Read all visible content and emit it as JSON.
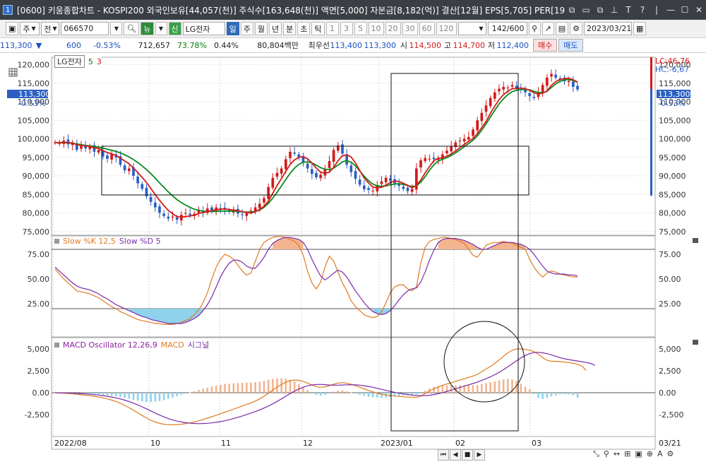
{
  "window": {
    "title": "[0600] 키움종합차트 - KOSPI200 외국인보유[44,057(천)] 주식수[163,648(천)] 액면[5,000] 자본금[8,182(억)] 결산[12월] EPS[5,705] PER[19.",
    "app_icon": "1"
  },
  "toolbar": {
    "period_type": "주",
    "market": "전",
    "code": "066570",
    "name": "LG전자",
    "new_label": "신",
    "units": [
      "일",
      "주",
      "월",
      "년",
      "분",
      "초",
      "틱"
    ],
    "minutes": [
      "1",
      "3",
      "5",
      "10",
      "20",
      "30",
      "60",
      "120"
    ],
    "count": "142",
    "count_total": "/600",
    "date": "2023/03/21"
  },
  "quote": {
    "price": "113,300",
    "change": "600",
    "change_pct": "-0.53%",
    "volume": "712,657",
    "vol_ratio": "73.78%",
    "turnover": "0.44%",
    "amount": "80,804백만",
    "best_ask_label": "최우선",
    "best_ask": "113,400",
    "best_bid": "113,300",
    "open_label": "시",
    "open": "114,500",
    "high_label": "고",
    "high": "114,700",
    "low_label": "저",
    "low": "112,400",
    "buy_label": "매수",
    "sell_label": "매도"
  },
  "price_panel": {
    "legend_name": "LG전자",
    "ma_short": "5",
    "ma_long": "3",
    "lc": "LC:46,76",
    "hc": "HC:-6,67",
    "last_price": "113,300",
    "last_change": "-0.53%"
  },
  "stoch_panel": {
    "legend_k": "Slow %K 12,5",
    "legend_d": "Slow %D 5"
  },
  "macd_panel": {
    "legend_osc": "MACD Oscillator 12,26,9",
    "legend_macd": "MACD",
    "legend_signal": "시그널"
  },
  "xaxis": {
    "labels": [
      "2022/08",
      "10",
      "11",
      "12",
      "2023/01",
      "02",
      "03"
    ],
    "right_label": "03/21"
  },
  "colors": {
    "up": "#d21a1a",
    "down": "#2a5fc4",
    "ma5": "#d21a1a",
    "ma20": "#0a8a1a",
    "stoch_k": "#e07a20",
    "stoch_d": "#7a2aa8",
    "macd": "#e07a20",
    "signal": "#7a2aa8",
    "osc_up": "#f3b48f",
    "osc_down": "#8fd2ec"
  },
  "chart_data": [
    {
      "type": "candlestick",
      "title": "LG전자",
      "ylim": [
        74000,
        122000
      ],
      "yticks": [
        75000,
        80000,
        85000,
        90000,
        95000,
        100000,
        105000,
        110000,
        115000,
        120000
      ],
      "ytick_labels": [
        "75,000",
        "80,000",
        "85,000",
        "90,000",
        "95,000",
        "100,000",
        "105,000",
        "110,000",
        "115,000",
        "120,000"
      ],
      "close": [
        99000,
        98800,
        99500,
        98500,
        99000,
        97000,
        98200,
        97400,
        98000,
        96500,
        97000,
        95200,
        94600,
        96000,
        95000,
        93000,
        91500,
        92000,
        90000,
        88000,
        86500,
        84500,
        83000,
        81500,
        80000,
        79200,
        78500,
        79000,
        78200,
        79500,
        80000,
        79400,
        79800,
        80800,
        80200,
        81200,
        80600,
        81500,
        81100,
        80900,
        80300,
        80800,
        79800,
        79400,
        79900,
        80600,
        81500,
        82500,
        84000,
        87000,
        89500,
        90800,
        92000,
        94500,
        96500,
        96000,
        95000,
        93500,
        92000,
        90500,
        89600,
        90300,
        91800,
        94000,
        97000,
        98200,
        96000,
        93000,
        91000,
        89200,
        87600,
        86400,
        86200,
        86000,
        87500,
        88500,
        89500,
        88800,
        88000,
        87300,
        86500,
        85900,
        86500,
        92000,
        94200,
        94800,
        94600,
        94500,
        94800,
        95800,
        96800,
        98000,
        99000,
        99500,
        100000,
        100500,
        102500,
        105000,
        107000,
        109000,
        111000,
        112500,
        113500,
        114000,
        113800,
        114500,
        113600,
        113200,
        112500,
        111500,
        111000,
        112500,
        114500,
        116500,
        117500,
        116500,
        116000,
        115500,
        115600,
        114000,
        113300
      ],
      "ma5": [
        99000,
        98900,
        99100,
        98900,
        98900,
        98400,
        98200,
        98100,
        97900,
        97600,
        97400,
        96800,
        96300,
        95900,
        95500,
        94800,
        94000,
        93300,
        92100,
        90900,
        89600,
        88200,
        86600,
        85000,
        83400,
        82000,
        80700,
        79800,
        79000,
        78900,
        79000,
        79200,
        79400,
        79900,
        80100,
        80400,
        80600,
        80900,
        81000,
        81100,
        80900,
        80800,
        80600,
        80300,
        80100,
        80000,
        80300,
        81000,
        81800,
        83200,
        85300,
        87400,
        89300,
        91200,
        93100,
        94300,
        95000,
        95200,
        94600,
        93500,
        92100,
        91000,
        90700,
        91000,
        92300,
        94100,
        95400,
        95700,
        95100,
        93500,
        91400,
        89400,
        88100,
        87000,
        86800,
        86900,
        87500,
        88200,
        88600,
        88500,
        88000,
        87400,
        86800,
        87400,
        88900,
        90800,
        92500,
        94100,
        94700,
        94900,
        95300,
        95900,
        96700,
        97600,
        98500,
        99300,
        100100,
        101400,
        103000,
        104700,
        106900,
        108800,
        110600,
        111900,
        112800,
        113500,
        113600,
        113700,
        113500,
        113100,
        112400,
        112100,
        112300,
        112900,
        114400,
        115400,
        116000,
        116300,
        116300,
        115900,
        115300
      ],
      "ma20": [
        99000,
        98950,
        99000,
        98900,
        98800,
        98600,
        98400,
        98200,
        98100,
        97900,
        97800,
        97500,
        97200,
        96900,
        96600,
        96200,
        95700,
        95100,
        94400,
        93600,
        92700,
        91700,
        90600,
        89400,
        88100,
        86900,
        85700,
        84600,
        83600,
        82800,
        82100,
        81500,
        81000,
        80700,
        80500,
        80400,
        80400,
        80400,
        80500,
        80500,
        80500,
        80500,
        80400,
        80300,
        80200,
        80200,
        80400,
        80800,
        81500,
        82600,
        84000,
        85600,
        87300,
        89000,
        90700,
        92100,
        93100,
        93700,
        93800,
        93500,
        92900,
        92200,
        91800,
        91700,
        92100,
        92900,
        93800,
        94100,
        93700,
        92700,
        91300,
        89900,
        88700,
        87800,
        87300,
        87200,
        87300,
        87600,
        87800,
        87900,
        87700,
        87400,
        87100,
        87300,
        88300,
        89800,
        91500,
        93000,
        94000,
        94500,
        94900,
        95500,
        96200,
        97000,
        97900,
        98700,
        99600,
        100800,
        102300,
        104000,
        105900,
        107700,
        109400,
        110800,
        111900,
        112700,
        113100,
        113300,
        113300,
        113200,
        112800,
        112500,
        112400,
        112800,
        113800,
        114800,
        115500,
        115900,
        116000,
        115700,
        115200
      ]
    },
    {
      "type": "line",
      "title": "Slow %K 12,5 / Slow %D 5",
      "ylim": [
        0,
        100
      ],
      "yticks": [
        25,
        50,
        75
      ],
      "ytick_labels": [
        "25.00",
        "50.00",
        "75.00"
      ],
      "reference_lines": [
        20,
        80
      ],
      "series": [
        {
          "name": "Slow %K 12,5",
          "values": [
            60,
            55,
            50,
            46,
            42,
            38,
            37,
            36,
            35,
            33,
            31,
            28,
            25,
            22,
            20,
            17,
            15,
            13,
            11,
            9,
            8,
            7,
            6,
            5,
            5,
            4,
            4,
            4,
            5,
            6,
            8,
            10,
            14,
            19,
            26,
            36,
            50,
            62,
            70,
            75,
            73,
            70,
            64,
            58,
            54,
            56,
            68,
            80,
            87,
            90,
            92,
            93,
            93,
            92,
            90,
            88,
            84,
            74,
            58,
            46,
            40,
            47,
            62,
            73,
            68,
            57,
            46,
            38,
            28,
            22,
            18,
            14,
            12,
            11,
            12,
            17,
            26,
            36,
            42,
            44,
            44,
            40,
            38,
            42,
            66,
            82,
            88,
            90,
            91,
            92,
            92,
            91,
            90,
            88,
            86,
            80,
            74,
            72,
            78,
            84,
            86,
            87,
            87,
            88,
            87,
            86,
            84,
            82,
            80,
            70,
            62,
            56,
            52,
            56,
            58,
            57,
            55,
            54,
            53,
            52,
            52
          ]
        },
        {
          "name": "Slow %D 5",
          "values": [
            62,
            58,
            54,
            50,
            46,
            43,
            41,
            40,
            39,
            37,
            35,
            32,
            30,
            27,
            24,
            22,
            20,
            18,
            16,
            14,
            12,
            11,
            9,
            8,
            7,
            6,
            5,
            5,
            5,
            5,
            6,
            8,
            10,
            13,
            18,
            24,
            32,
            42,
            52,
            60,
            66,
            69,
            69,
            67,
            63,
            61,
            61,
            66,
            72,
            80,
            86,
            89,
            91,
            92,
            92,
            91,
            90,
            87,
            80,
            70,
            61,
            53,
            49,
            52,
            56,
            59,
            57,
            52,
            45,
            38,
            32,
            26,
            21,
            17,
            15,
            14,
            15,
            18,
            23,
            29,
            34,
            38,
            40,
            41,
            47,
            57,
            69,
            79,
            87,
            90,
            91,
            91,
            91,
            90,
            89,
            87,
            85,
            82,
            80,
            80,
            82,
            84,
            86,
            87,
            87,
            87,
            86,
            85,
            83,
            80,
            75,
            69,
            63,
            58,
            56,
            55,
            55,
            55,
            54,
            54,
            53
          ]
        }
      ]
    },
    {
      "type": "bar+line",
      "title": "MACD Oscillator 12,26,9",
      "ylim": [
        -4500,
        6000
      ],
      "yticks": [
        -2500,
        0,
        2500,
        5000
      ],
      "ytick_labels": [
        "-2,500",
        "0.00",
        "2,500",
        "5,000"
      ],
      "series": [
        {
          "name": "MACD",
          "values": [
            0,
            -40,
            -60,
            -90,
            -120,
            -180,
            -230,
            -280,
            -330,
            -400,
            -480,
            -580,
            -700,
            -850,
            -1000,
            -1200,
            -1450,
            -1700,
            -2000,
            -2300,
            -2600,
            -2900,
            -3150,
            -3350,
            -3500,
            -3600,
            -3650,
            -3660,
            -3640,
            -3600,
            -3520,
            -3440,
            -3330,
            -3200,
            -3060,
            -2900,
            -2740,
            -2570,
            -2400,
            -2220,
            -2050,
            -1880,
            -1700,
            -1520,
            -1340,
            -1160,
            -950,
            -700,
            -400,
            -50,
            300,
            650,
            950,
            1200,
            1370,
            1450,
            1420,
            1300,
            1100,
            880,
            700,
            620,
            680,
            800,
            970,
            1100,
            1150,
            1080,
            960,
            800,
            620,
            440,
            260,
            100,
            -40,
            -160,
            -260,
            -330,
            -380,
            -420,
            -460,
            -500,
            -520,
            -540,
            -380,
            -100,
            200,
            450,
            650,
            850,
            1000,
            1150,
            1300,
            1450,
            1600,
            1750,
            1900,
            2100,
            2400,
            2700,
            3000,
            3350,
            3750,
            4150,
            4550,
            4850,
            5000,
            5000,
            4950,
            4850,
            4700,
            4400,
            4000,
            3700,
            3600,
            3580,
            3550,
            3500,
            3450,
            3350,
            3250,
            3050,
            2550
          ]
        },
        {
          "name": "시그널",
          "values": [
            0,
            -10,
            -20,
            -35,
            -55,
            -80,
            -110,
            -140,
            -180,
            -220,
            -270,
            -330,
            -400,
            -490,
            -590,
            -710,
            -850,
            -1010,
            -1190,
            -1390,
            -1610,
            -1840,
            -2080,
            -2320,
            -2550,
            -2760,
            -2950,
            -3110,
            -3240,
            -3340,
            -3420,
            -3480,
            -3510,
            -3530,
            -3520,
            -3490,
            -3440,
            -3380,
            -3300,
            -3200,
            -3080,
            -2950,
            -2810,
            -2650,
            -2490,
            -2320,
            -2150,
            -1960,
            -1750,
            -1520,
            -1270,
            -990,
            -700,
            -400,
            -100,
            180,
            430,
            630,
            790,
            890,
            940,
            950,
            920,
            880,
            860,
            860,
            880,
            900,
            910,
            900,
            860,
            800,
            720,
            620,
            510,
            390,
            270,
            150,
            40,
            -60,
            -140,
            -210,
            -270,
            -320,
            -340,
            -330,
            -290,
            -210,
            -110,
            10,
            150,
            300,
            450,
            600,
            750,
            900,
            1050,
            1220,
            1400,
            1600,
            1820,
            2060,
            2330,
            2630,
            2960,
            3300,
            3650,
            3970,
            4250,
            4460,
            4580,
            4610,
            4560,
            4460,
            4320,
            4160,
            4000,
            3880,
            3780,
            3700,
            3620,
            3540,
            3450,
            3350,
            3120
          ]
        },
        {
          "name": "MACD Oscillator 12,26,9",
          "values": [
            0,
            -30,
            -40,
            -55,
            -65,
            -100,
            -120,
            -140,
            -150,
            -180,
            -210,
            -250,
            -300,
            -360,
            -410,
            -490,
            -600,
            -690,
            -810,
            -910,
            -990,
            -1060,
            -1070,
            -1030,
            -950,
            -840,
            -700,
            -550,
            -400,
            -260,
            -100,
            40,
            180,
            330,
            460,
            590,
            700,
            810,
            900,
            980,
            1030,
            1070,
            1110,
            1130,
            1150,
            1160,
            1200,
            1260,
            1350,
            1470,
            1570,
            1640,
            1650,
            1600,
            1470,
            1270,
            990,
            670,
            310,
            -10,
            -240,
            -330,
            -240,
            -80,
            110,
            240,
            270,
            180,
            50,
            -100,
            -240,
            -360,
            -460,
            -520,
            -550,
            -550,
            -530,
            -480,
            -420,
            -360,
            -320,
            -290,
            -250,
            -220,
            -40,
            230,
            490,
            660,
            760,
            840,
            850,
            850,
            850,
            850,
            850,
            850,
            850,
            880,
            1000,
            1100,
            1180,
            1290,
            1420,
            1520,
            1590,
            1550,
            1350,
            1030,
            700,
            390,
            -160,
            -600,
            -720,
            -580,
            -420,
            -300,
            -200,
            -170,
            -200,
            -300,
            -570
          ]
        }
      ]
    }
  ]
}
